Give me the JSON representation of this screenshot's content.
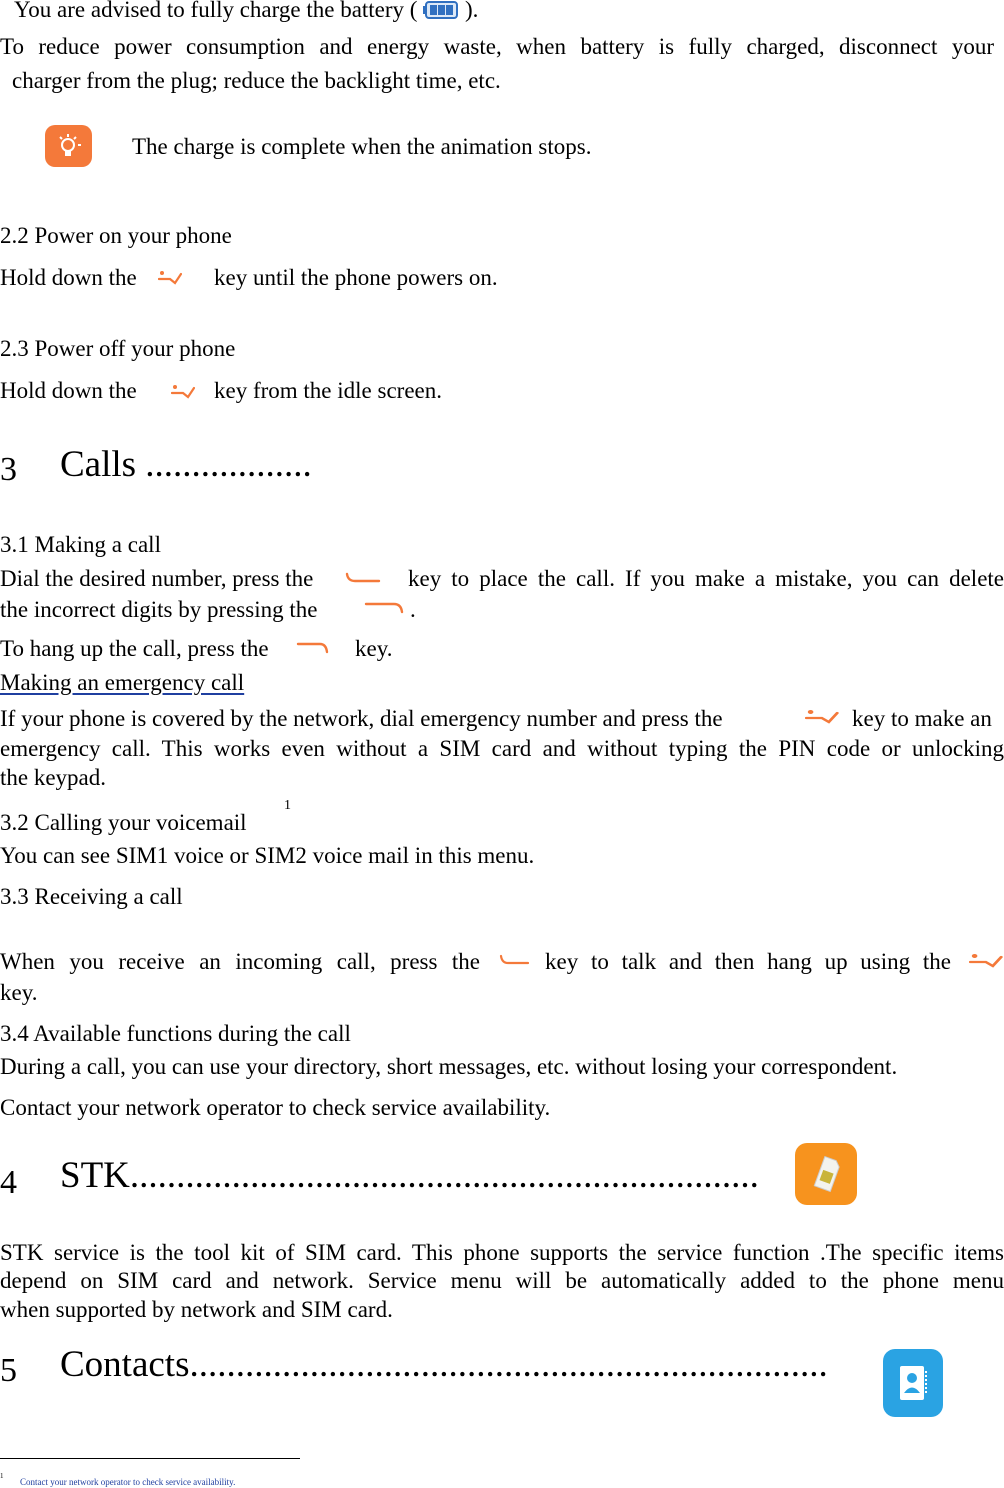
{
  "charging": {
    "advise_before": "You are advised to fully charge the battery (",
    "advise_after": ").",
    "reduce_line1": "To reduce power consumption and energy waste, when battery is fully charged, disconnect your",
    "reduce_line2": "charger from the plug; reduce the backlight time, etc.",
    "tip": "The charge is complete when the animation stops."
  },
  "power_on": {
    "heading": "2.2  Power on your phone",
    "before": "Hold down the",
    "after": "key until the phone powers on."
  },
  "power_off": {
    "heading": "2.3  Power off your phone",
    "before": "Hold down the",
    "after": "key from the idle screen."
  },
  "calls": {
    "number": "3",
    "title": "Calls ..................",
    "making": {
      "heading": "3.1  Making a call",
      "l1a": "Dial the desired number, press the",
      "l1b": "key to place the call. If you make a mistake, you can delete",
      "l2a": "the incorrect digits by pressing the",
      "l2b": ".",
      "l3a": "To hang up the call, press the",
      "l3b": "key."
    },
    "emergency": {
      "heading": "Making an emergency call",
      "l1a": "If your phone is covered by the network, dial emergency number and press the",
      "l1b": "key to make an",
      "l2": "emergency call. This works even without a SIM card and without typing the PIN code or unlocking",
      "l3": "the keypad."
    },
    "voicemail": {
      "heading": "3.2  Calling your voicemail",
      "footnote_ref": "1",
      "text": "You can see SIM1 voice or SIM2 voice mail in this menu."
    },
    "receiving": {
      "heading": "3.3  Receiving a call",
      "l1a": "When you receive an incoming call, press the",
      "l1b": "key to talk and then hang up using the",
      "l2": "key."
    },
    "functions": {
      "heading": "3.4  Available functions during the call",
      "l1": "During a call, you can use your directory, short messages, etc. without losing your correspondent.",
      "l2": "Contact your network operator to check service availability."
    }
  },
  "stk": {
    "number": "4",
    "title": "STK....................................................................",
    "l1": "STK service is the tool kit of SIM card. This phone supports the service function .The specific items",
    "l2": "depend on SIM card and network. Service menu will be automatically added to the phone menu",
    "l3": "when supported by network and SIM card."
  },
  "contacts": {
    "number": "5",
    "title": "Contacts.....................................................................",
    "icon": "contacts-icon"
  },
  "footnote": {
    "mark": "1",
    "text": "Contact your network operator to check service availability."
  },
  "colors": {
    "accent_orange": "#f4793a",
    "stk_orange": "#f7931e",
    "contacts_blue": "#2aa3e3",
    "battery_blue": "#2f6fc0"
  }
}
